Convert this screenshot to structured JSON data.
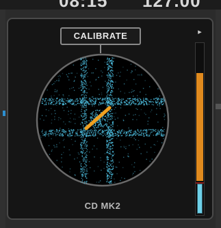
{
  "header": {
    "time": "08:15",
    "bpm": "127.00"
  },
  "deck": {
    "calibrate_label": "CALIBRATE",
    "controller_name": "CD MK2",
    "expand_icon": "chevron-right-icon",
    "meter_level": 0.78,
    "colors": {
      "scope_points": "#4fc3e6",
      "needle": "#f0a020",
      "meter": "#e08a1e",
      "meter_low": "#6ed0e8"
    }
  }
}
